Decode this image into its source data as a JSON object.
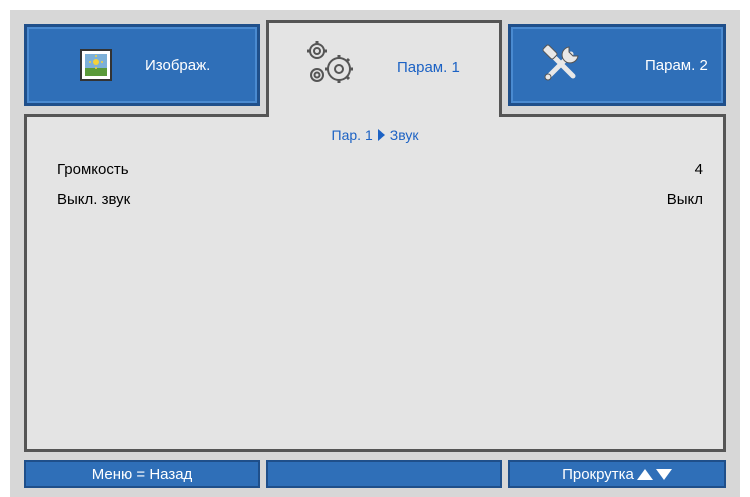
{
  "tabs": [
    {
      "label": "Изображ.",
      "icon": "picture-icon",
      "active": false
    },
    {
      "label": "Парам. 1",
      "icon": "gears-icon",
      "active": true
    },
    {
      "label": "Парам. 2",
      "icon": "tools-icon",
      "active": false
    }
  ],
  "breadcrumb": {
    "parent": "Пар. 1",
    "current": "Звук"
  },
  "settings": [
    {
      "label": "Громкость",
      "value": "4"
    },
    {
      "label": "Выкл. звук",
      "value": "Выкл"
    }
  ],
  "footer": {
    "back_hint": "Меню = Назад",
    "middle": "",
    "scroll_hint": "Прокрутка"
  },
  "colors": {
    "tab_blue": "#2f6fb8",
    "panel_bg": "#e4e4e4",
    "osd_bg": "#d7d7d7",
    "accent_text": "#1c62c4"
  }
}
